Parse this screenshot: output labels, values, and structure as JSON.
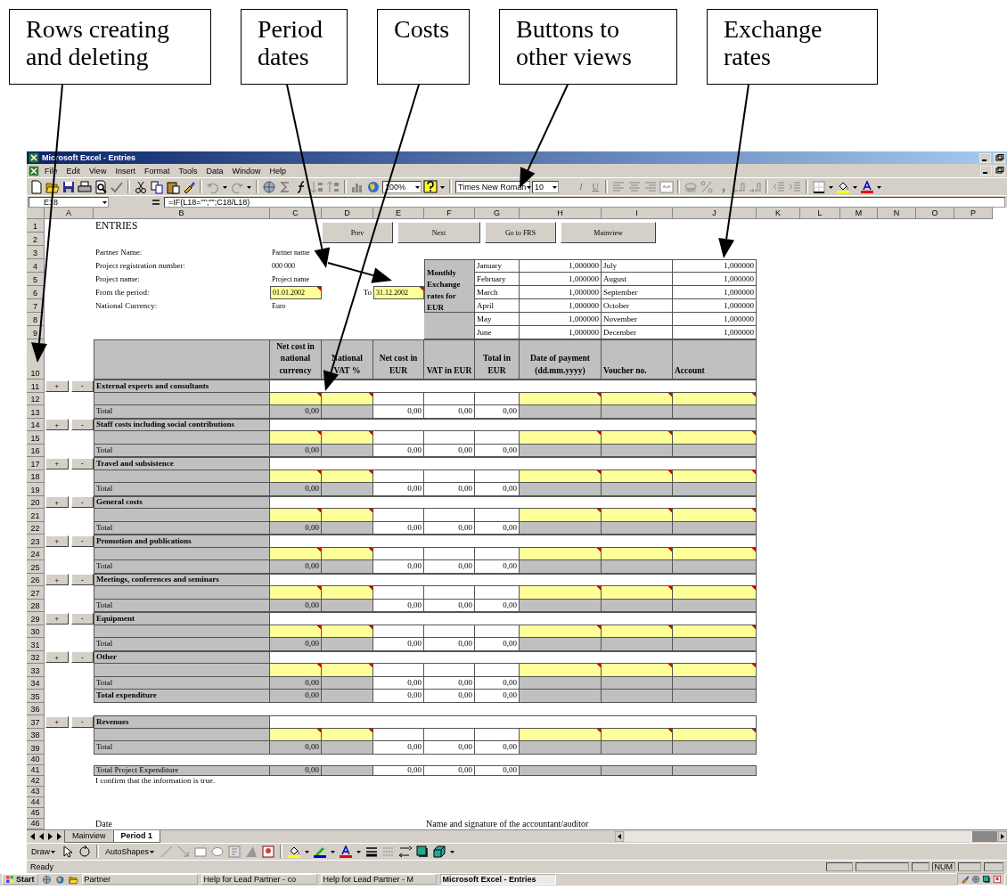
{
  "callouts": [
    {
      "text": "Rows creating and deleting"
    },
    {
      "text": "Period dates"
    },
    {
      "text": "Costs"
    },
    {
      "text": "Buttons to other views"
    },
    {
      "text": "Exchange rates"
    }
  ],
  "window": {
    "title": "Microsoft Excel - Entries"
  },
  "menu": [
    "File",
    "Edit",
    "View",
    "Insert",
    "Format",
    "Tools",
    "Data",
    "Window",
    "Help"
  ],
  "toolbar": {
    "zoom": "100%",
    "font": "Times New Roman",
    "size": "10",
    "style_buttons": [
      "I",
      "U"
    ]
  },
  "formula_bar": {
    "cell": "E18",
    "formula": "=IF(L18=\"\";\"\";C18/L18)"
  },
  "columns": [
    "A",
    "B",
    "C",
    "D",
    "E",
    "F",
    "G",
    "H",
    "I",
    "J",
    "K",
    "L",
    "M",
    "N",
    "O",
    "P"
  ],
  "rows": [
    "1",
    "2",
    "3",
    "4",
    "5",
    "6",
    "7",
    "8",
    "9",
    "10",
    "11",
    "12",
    "13",
    "14",
    "15",
    "16",
    "17",
    "18",
    "19",
    "20",
    "21",
    "22",
    "23",
    "24",
    "25",
    "26",
    "27",
    "28",
    "29",
    "30",
    "31",
    "32",
    "33",
    "34",
    "35",
    "36",
    "37",
    "38",
    "39",
    "40",
    "41",
    "42",
    "43",
    "44",
    "45",
    "46"
  ],
  "sheet": {
    "title": "ENTRIES",
    "nav_buttons": [
      "Prev",
      "Next",
      "Go to FRS",
      "Mainview"
    ],
    "info": [
      {
        "kind": "text",
        "label": "Partner Name:",
        "value": "Partner name"
      },
      {
        "kind": "text",
        "label": "Project registration number:",
        "value": "000 000"
      },
      {
        "kind": "text",
        "label": "Project name:",
        "value": "Project name"
      },
      {
        "kind": "input",
        "label": "From the period:",
        "value": "01.01.2002"
      },
      {
        "kind": "text",
        "label": "National Currency:",
        "value": "Euro"
      }
    ],
    "period_to": {
      "label": "To",
      "value": "31.12.2002"
    },
    "exchange": {
      "heading": "Monthly Exchange rates for EUR",
      "rates": [
        {
          "month": "January",
          "rate": "1,000000"
        },
        {
          "month": "February",
          "rate": "1,000000"
        },
        {
          "month": "March",
          "rate": "1,000000"
        },
        {
          "month": "April",
          "rate": "1,000000"
        },
        {
          "month": "May",
          "rate": "1,000000"
        },
        {
          "month": "June",
          "rate": "1,000000"
        },
        {
          "month": "July",
          "rate": "1,000000"
        },
        {
          "month": "August",
          "rate": "1,000000"
        },
        {
          "month": "September",
          "rate": "1,000000"
        },
        {
          "month": "October",
          "rate": "1,000000"
        },
        {
          "month": "November",
          "rate": "1,000000"
        },
        {
          "month": "December",
          "rate": "1,000000"
        }
      ]
    },
    "table": {
      "columns": [
        "Net cost in national currency",
        "National VAT %",
        "Net cost  in EUR",
        "VAT in EUR",
        "Total in EUR",
        "Date of payment (dd.mm.yyyy)",
        "Voucher no.",
        "Account"
      ],
      "sections": [
        {
          "kind": "cost",
          "title": "External experts and consultants",
          "add": "+",
          "remove": "-",
          "total_label": "Total",
          "totals": [
            "0,00",
            "0,00",
            "0,00",
            "0,00"
          ]
        },
        {
          "kind": "cost",
          "title": "Staff costs including social  contributions",
          "add": "+",
          "remove": "-",
          "total_label": "Total",
          "totals": [
            "0,00",
            "0,00",
            "0,00",
            "0,00"
          ]
        },
        {
          "kind": "cost",
          "title": "Travel and subsistence",
          "add": "+",
          "remove": "-",
          "total_label": "Total",
          "totals": [
            "0,00",
            "0,00",
            "0,00",
            "0,00"
          ]
        },
        {
          "kind": "cost",
          "title": "General costs",
          "add": "+",
          "remove": "-",
          "total_label": "Total",
          "totals": [
            "0,00",
            "0,00",
            "0,00",
            "0,00"
          ]
        },
        {
          "kind": "cost",
          "title": "Promotion and publications",
          "add": "+",
          "remove": "-",
          "total_label": "Total",
          "totals": [
            "0,00",
            "0,00",
            "0,00",
            "0,00"
          ]
        },
        {
          "kind": "cost",
          "title": "Meetings, conferences and seminars",
          "add": "+",
          "remove": "-",
          "total_label": "Total",
          "totals": [
            "0,00",
            "0,00",
            "0,00",
            "0,00"
          ]
        },
        {
          "kind": "cost",
          "title": "Equipment",
          "add": "+",
          "remove": "-",
          "total_label": "Total",
          "totals": [
            "0,00",
            "0,00",
            "0,00",
            "0,00"
          ]
        },
        {
          "kind": "cost",
          "title": "Other",
          "add": "+",
          "remove": "-",
          "total_label": "Total",
          "totals": [
            "0,00",
            "0,00",
            "0,00",
            "0,00"
          ]
        },
        {
          "kind": "revenue",
          "title": "Revenues",
          "add": "+",
          "remove": "-",
          "total_label": "Total",
          "totals": [
            "0,00",
            "0,00",
            "0,00",
            "0,00"
          ]
        }
      ],
      "grand_total": {
        "label": "Total expenditure",
        "values": [
          "0,00",
          "0,00",
          "0,00",
          "0,00"
        ]
      },
      "project_total": {
        "label": "Total Project Expenditure",
        "values": [
          "0,00",
          "0,00",
          "0,00",
          "0,00"
        ]
      }
    },
    "confirmation": "I confirm that the information is true.",
    "date_label": "Date",
    "signature_label": "Name and signature of the accountant/auditor"
  },
  "sheet_tabs": [
    {
      "label": "Mainview",
      "selected": false
    },
    {
      "label": "Period 1",
      "selected": true
    }
  ],
  "draw_toolbar": {
    "draw": "Draw",
    "autoshapes": "AutoShapes"
  },
  "status_bar": {
    "text": "Ready",
    "indicator": "NUM"
  },
  "taskbar": {
    "start": "Start",
    "tasks": [
      {
        "label": "Partner",
        "selected": false
      },
      {
        "label": "Help for Lead Partner - co",
        "selected": false
      },
      {
        "label": "Help for Lead Partner - M",
        "selected": false
      },
      {
        "label": "Microsoft Excel - Entries",
        "selected": true
      }
    ]
  }
}
